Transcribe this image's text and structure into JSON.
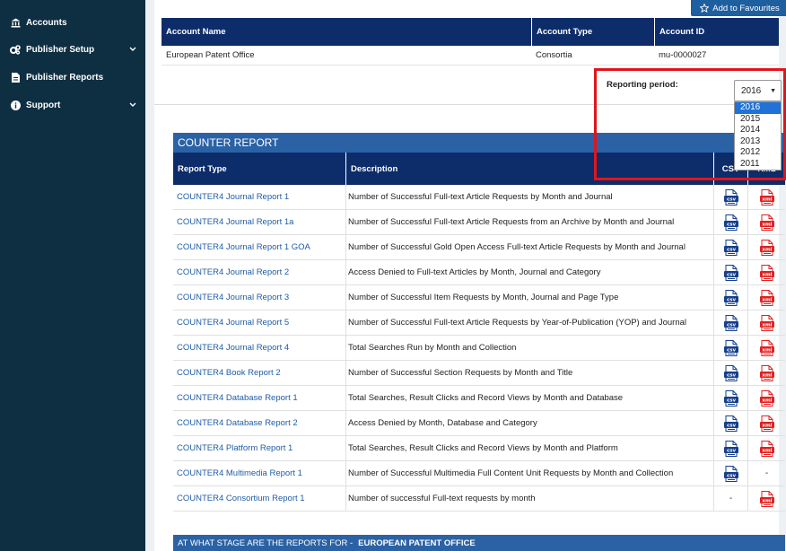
{
  "sidebar": {
    "items": [
      {
        "label": "Accounts",
        "icon": "institution-icon",
        "has_chevron": false
      },
      {
        "label": "Publisher Setup",
        "icon": "gears-icon",
        "has_chevron": true
      },
      {
        "label": "Publisher Reports",
        "icon": "file-icon",
        "has_chevron": false
      },
      {
        "label": "Support",
        "icon": "info-icon",
        "has_chevron": true
      }
    ]
  },
  "header": {
    "favourites_label": "Add to Favourites"
  },
  "account_table": {
    "columns": [
      "Account Name",
      "Account Type",
      "Account ID"
    ],
    "row": {
      "name": "European Patent Office",
      "type": "Consortia",
      "id": "mu-0000027"
    }
  },
  "reporting_period": {
    "label": "Reporting period:",
    "selected": "2016",
    "options": [
      "2016",
      "2015",
      "2014",
      "2013",
      "2012",
      "2011"
    ]
  },
  "counter": {
    "title": "COUNTER REPORT",
    "columns": {
      "type": "Report Type",
      "desc": "Description",
      "csv": "CSV",
      "xml": "XML"
    },
    "rows": [
      {
        "name": "COUNTER4 Journal Report 1",
        "desc": "Number of Successful Full-text Article Requests by Month and Journal",
        "csv": true,
        "xml": true
      },
      {
        "name": "COUNTER4 Journal Report 1a",
        "desc": "Number of Successful Full-text Article Requests from an Archive by Month and Journal",
        "csv": true,
        "xml": true
      },
      {
        "name": "COUNTER4 Journal Report 1 GOA",
        "desc": "Number of Successful Gold Open Access Full-text Article Requests by Month and Journal",
        "csv": true,
        "xml": true
      },
      {
        "name": "COUNTER4 Journal Report 2",
        "desc": "Access Denied to Full-text Articles by Month, Journal and Category",
        "csv": true,
        "xml": true
      },
      {
        "name": "COUNTER4 Journal Report 3",
        "desc": "Number of Successful Item Requests by Month, Journal and Page Type",
        "csv": true,
        "xml": true
      },
      {
        "name": "COUNTER4 Journal Report 5",
        "desc": "Number of Successful Full-text Article Requests by Year-of-Publication (YOP) and Journal",
        "csv": true,
        "xml": true
      },
      {
        "name": "COUNTER4 Journal Report 4",
        "desc": "Total Searches Run by Month and Collection",
        "csv": true,
        "xml": true
      },
      {
        "name": "COUNTER4 Book Report 2",
        "desc": "Number of Successful Section Requests by Month and Title",
        "csv": true,
        "xml": true
      },
      {
        "name": "COUNTER4 Database Report 1",
        "desc": "Total Searches, Result Clicks and Record Views by Month and Database",
        "csv": true,
        "xml": true
      },
      {
        "name": "COUNTER4 Database Report 2",
        "desc": "Access Denied by Month, Database and Category",
        "csv": true,
        "xml": true
      },
      {
        "name": "COUNTER4 Platform Report 1",
        "desc": "Total Searches, Result Clicks and Record Views by Month and Platform",
        "csv": true,
        "xml": true
      },
      {
        "name": "COUNTER4 Multimedia Report 1",
        "desc": "Number of Successful Multimedia Full Content Unit Requests by Month and Collection",
        "csv": true,
        "xml": false
      },
      {
        "name": "COUNTER4 Consortium Report 1",
        "desc": "Number of successful Full-text requests by month",
        "csv": false,
        "xml": true
      }
    ],
    "missing_symbol": "-"
  },
  "stage_bar": {
    "prefix": "AT WHAT STAGE ARE THE REPORTS FOR -",
    "org": "EUROPEAN PATENT OFFICE"
  },
  "colors": {
    "sidebar_bg": "#0e2e42",
    "header_navy": "#0d2c6a",
    "counter_blue": "#2b62a6",
    "link_blue": "#1f5da8",
    "highlight_red": "#e0151b",
    "csv_icon": "#163f8c",
    "xml_icon": "#e02020"
  }
}
